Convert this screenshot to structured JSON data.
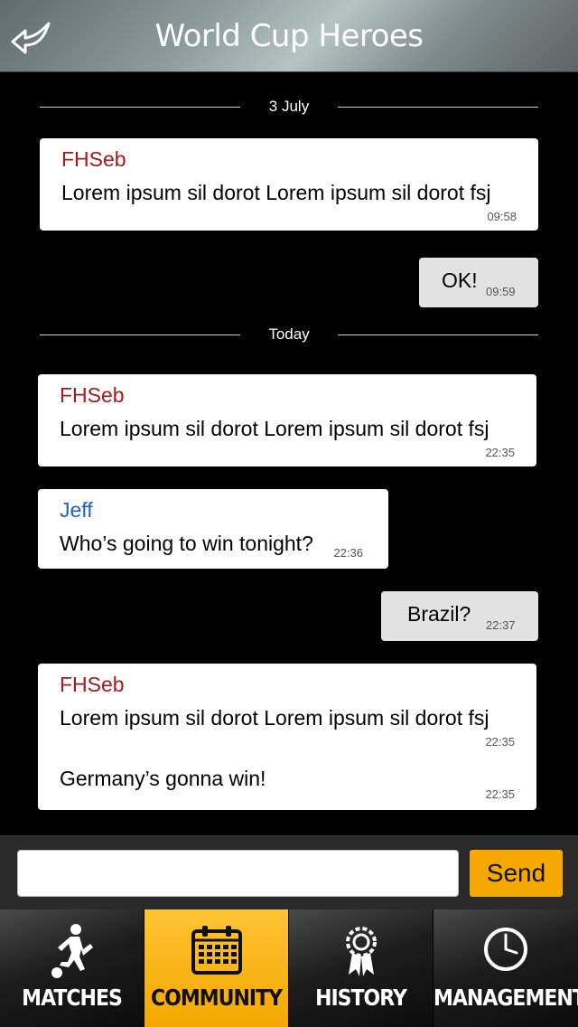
{
  "header": {
    "title": "World Cup Heroes",
    "back_icon": "back-arrow-icon"
  },
  "chat": {
    "dividers": [
      "3 July",
      "Today"
    ],
    "messages": [
      {
        "author": "FHSeb",
        "text": "Lorem ipsum sil dorot Lorem ipsum sil dorot fsj",
        "time": "09:58"
      },
      {
        "mine": true,
        "text": "OK!",
        "time": "09:59"
      },
      {
        "author": "FHSeb",
        "text": "Lorem ipsum sil dorot Lorem ipsum sil dorot fsj",
        "time": "22:35"
      },
      {
        "author": "Jeff",
        "text": "Who’s going to win tonight?",
        "time": "22:36"
      },
      {
        "mine": true,
        "text": "Brazil?",
        "time": "22:37"
      },
      {
        "author": "FHSeb",
        "text": "Lorem ipsum sil dorot Lorem ipsum sil dorot fsj",
        "time": "22:35",
        "text2": "Germany’s gonna win!",
        "time2": "22:35"
      }
    ]
  },
  "composer": {
    "value": "",
    "placeholder": "",
    "send_label": "Send"
  },
  "tabs": [
    {
      "label": "MATCHES",
      "icon": "soccer-player-icon",
      "active": false
    },
    {
      "label": "COMMUNITY",
      "icon": "calendar-icon",
      "active": true
    },
    {
      "label": "HISTORY",
      "icon": "award-ribbon-icon",
      "active": false
    },
    {
      "label": "MANAGEMENT",
      "icon": "clock-icon",
      "active": false
    }
  ],
  "colors": {
    "accent": "#f5a800",
    "author_red": "#a31b1b",
    "author_blue": "#1d5fcc"
  }
}
